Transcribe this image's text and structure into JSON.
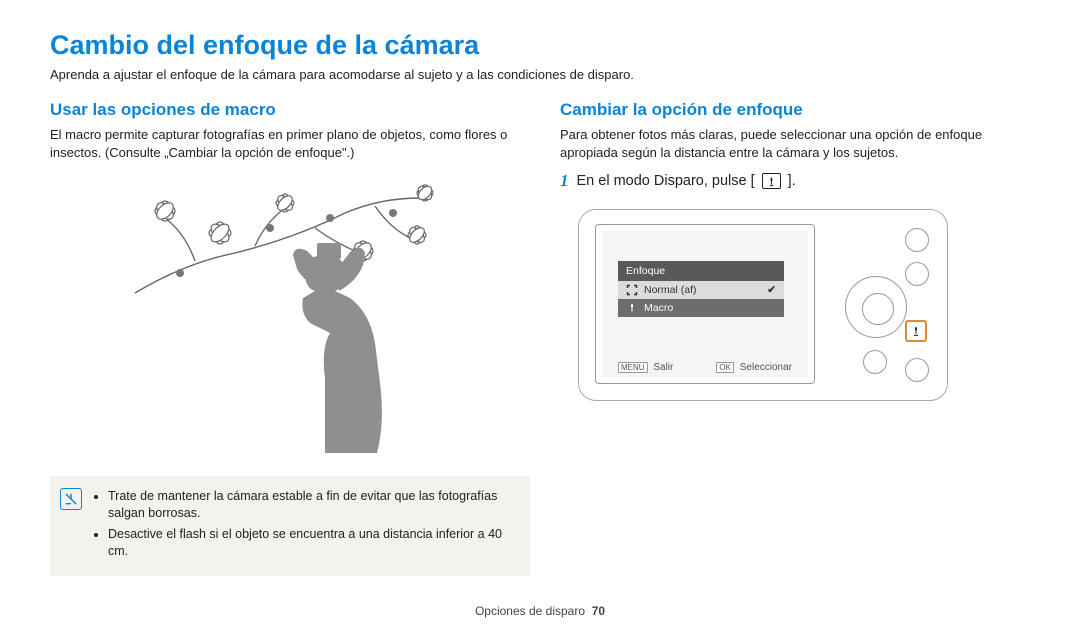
{
  "title": "Cambio del enfoque de la cámara",
  "intro": "Aprenda a ajustar el enfoque de la cámara para acomodarse al sujeto y a las condiciones de disparo.",
  "left": {
    "heading": "Usar las opciones de macro",
    "body": "El macro permite capturar fotografías en primer plano de objetos, como flores o insectos. (Consulte „Cambiar la opción de enfoque\".)",
    "tip1": "Trate de mantener la cámara estable a fin de evitar que las fotografías salgan borrosas.",
    "tip2": "Desactive el flash si el objeto se encuentra a una distancia inferior a 40 cm."
  },
  "right": {
    "heading": "Cambiar la opción de enfoque",
    "body": "Para obtener fotos más claras, puede seleccionar una opción de enfoque apropiada según la distancia entre la cámara y los sujetos.",
    "step_num": "1",
    "step_text_a": "En el modo Disparo, pulse [",
    "step_text_b": "].",
    "screen": {
      "menu_title": "Enfoque",
      "opt1": "Normal (af)",
      "opt2": "Macro",
      "menu_tag": "MENU",
      "exit_label": "Salir",
      "ok_tag": "OK",
      "select_label": "Seleccionar"
    }
  },
  "footer_label": "Opciones de disparo",
  "page_num": "70"
}
